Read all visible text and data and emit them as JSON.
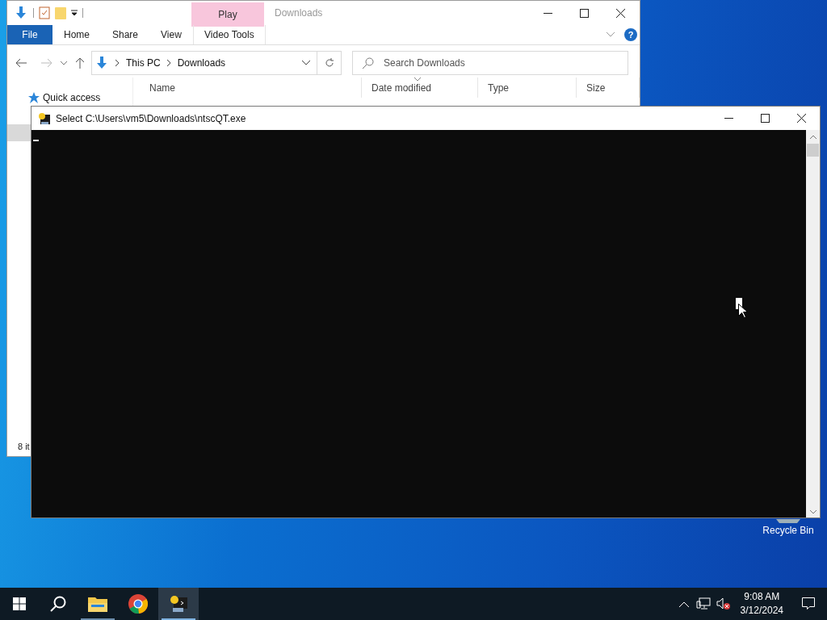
{
  "explorer": {
    "title": "Downloads",
    "contextual_group": "Play",
    "ribbon_tabs": [
      {
        "label": "File",
        "kind": "file",
        "selected": false
      },
      {
        "label": "Home",
        "kind": "tab",
        "selected": false
      },
      {
        "label": "Share",
        "kind": "tab",
        "selected": false
      },
      {
        "label": "View",
        "kind": "tab",
        "selected": false
      },
      {
        "label": "Video Tools",
        "kind": "contextual",
        "selected": false
      }
    ],
    "help": "?",
    "breadcrumb": [
      "This PC",
      "Downloads"
    ],
    "search": {
      "placeholder": "Search Downloads"
    },
    "columns": [
      {
        "label": "Name",
        "sorted": false
      },
      {
        "label": "Date modified",
        "sorted": true
      },
      {
        "label": "Type",
        "sorted": false
      },
      {
        "label": "Size",
        "sorted": false
      }
    ],
    "nav_items": [
      {
        "label": "Quick access"
      }
    ],
    "status": "8 it"
  },
  "console": {
    "title": "Select C:\\Users\\vm5\\Downloads\\ntscQT.exe"
  },
  "desktop_icons": [
    {
      "label": "Recycle Bin"
    }
  ],
  "taskbar": {
    "apps": [
      {
        "kind": "explorer",
        "running": true,
        "active": false
      },
      {
        "kind": "chrome",
        "running": false,
        "active": false
      },
      {
        "kind": "console",
        "running": true,
        "active": true
      }
    ],
    "time": "9:08 AM",
    "date": "3/12/2024"
  }
}
